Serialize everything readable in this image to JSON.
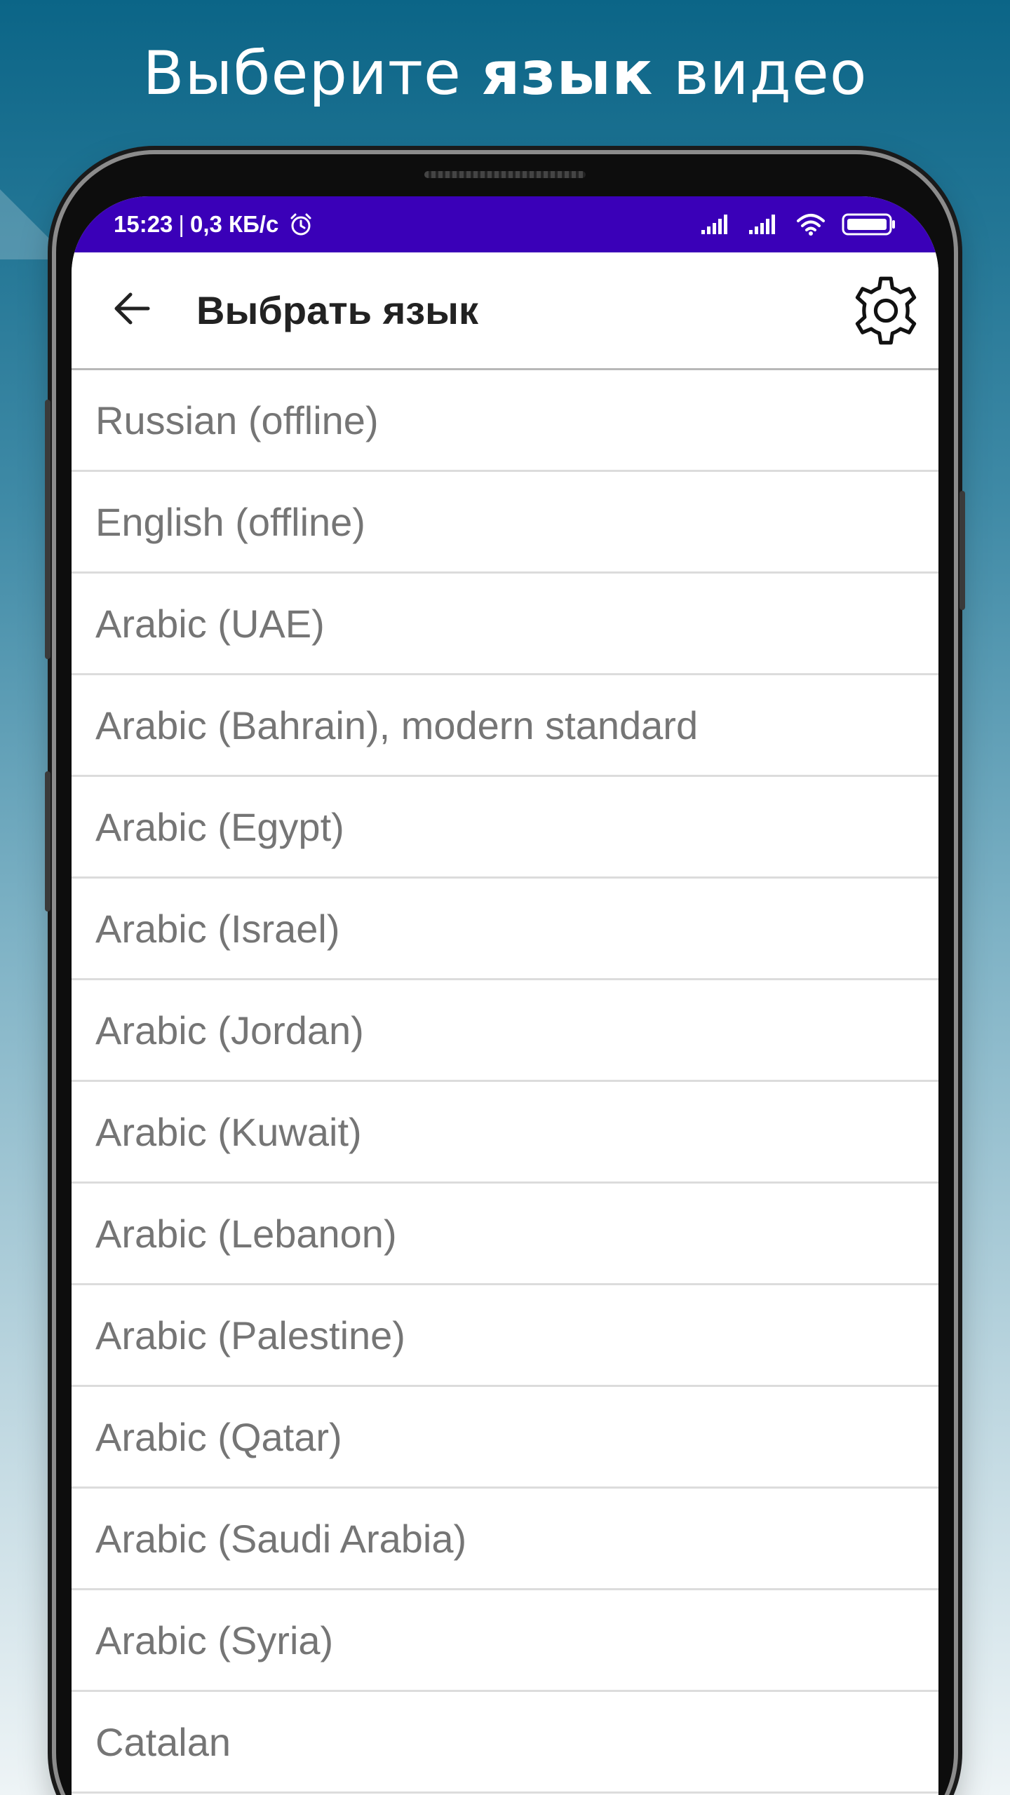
{
  "promo": {
    "title_part1": "Выберите",
    "title_bold": "язык",
    "title_part2": "видео"
  },
  "status_bar": {
    "time": "15:23",
    "separator": "|",
    "net_speed": "0,3 КБ/с",
    "alarm_icon": "alarm-clock-icon",
    "signal_icon_1": "cellular-signal-icon",
    "signal_icon_2": "cellular-signal-icon",
    "wifi_icon": "wifi-icon",
    "battery_icon": "battery-icon",
    "background_color": "#3a00b8"
  },
  "toolbar": {
    "back_icon": "arrow-left-icon",
    "title": "Выбрать язык",
    "settings_icon": "gear-icon"
  },
  "languages": [
    "Russian (offline)",
    "English (offline)",
    "Arabic (UAE)",
    "Arabic (Bahrain), modern standard",
    "Arabic (Egypt)",
    "Arabic (Israel)",
    "Arabic (Jordan)",
    "Arabic (Kuwait)",
    "Arabic (Lebanon)",
    "Arabic (Palestine)",
    "Arabic (Qatar)",
    "Arabic (Saudi Arabia)",
    "Arabic (Syria)",
    "Catalan"
  ],
  "colors": {
    "background_top": "#0b6587",
    "background_bottom": "#eef4f6",
    "list_text": "#757575",
    "title_text": "#222222"
  }
}
